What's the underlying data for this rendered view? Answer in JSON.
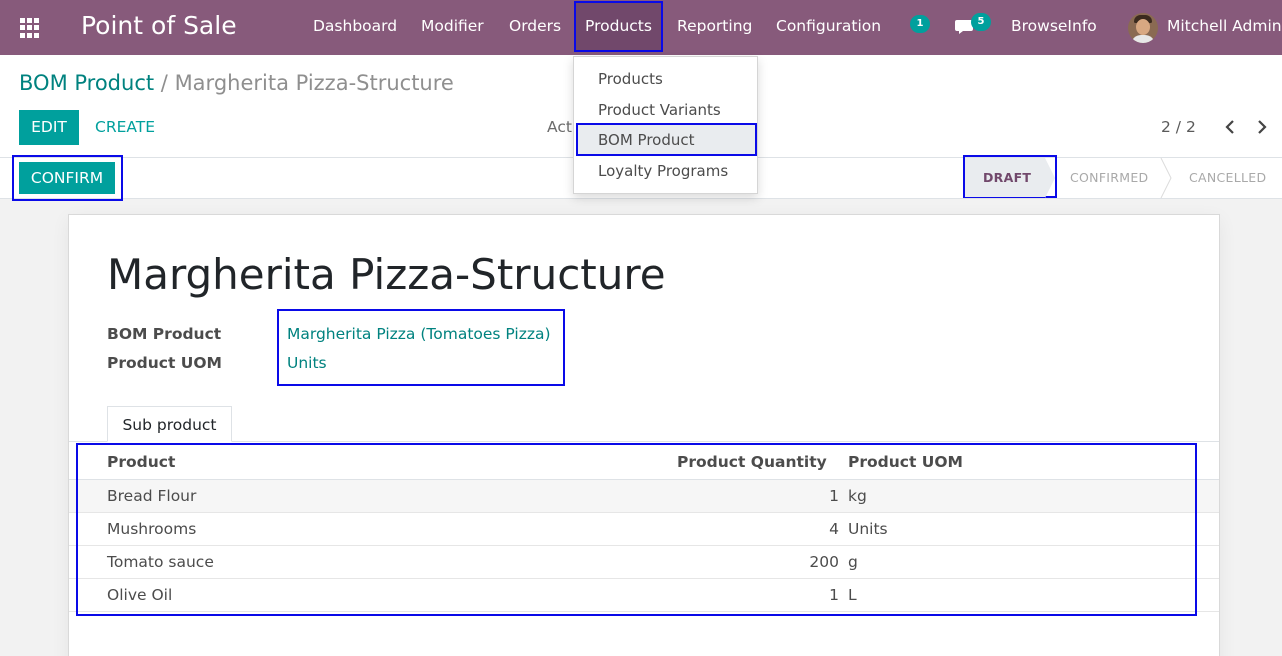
{
  "navbar": {
    "app_title": "Point of Sale",
    "menus": [
      "Dashboard",
      "Modifier",
      "Orders",
      "Products",
      "Reporting",
      "Configuration"
    ],
    "activity_badge": "1",
    "messages_badge": "5",
    "company": "BrowseInfo",
    "user": "Mitchell Admin"
  },
  "breadcrumb": {
    "parent": "BOM Product",
    "separator": "/",
    "current": "Margherita Pizza-Structure"
  },
  "buttons": {
    "edit": "EDIT",
    "create": "CREATE",
    "action": "Act",
    "confirm": "CONFIRM"
  },
  "pager": "2 / 2",
  "status_stages": [
    "DRAFT",
    "CONFIRMED",
    "CANCELLED"
  ],
  "dropdown": {
    "items": [
      "Products",
      "Product Variants",
      "BOM Product",
      "Loyalty Programs"
    ]
  },
  "form": {
    "title": "Margherita Pizza-Structure",
    "fields": [
      {
        "label": "BOM Product",
        "value": "Margherita Pizza (Tomatoes Pizza)"
      },
      {
        "label": "Product UOM",
        "value": "Units"
      }
    ],
    "tab": "Sub product",
    "table": {
      "headers": [
        "Product",
        "Product Quantity",
        "Product UOM"
      ],
      "rows": [
        {
          "product": "Bread Flour",
          "qty": "1",
          "uom": "kg"
        },
        {
          "product": "Mushrooms",
          "qty": "4",
          "uom": "Units"
        },
        {
          "product": "Tomato sauce",
          "qty": "200",
          "uom": "g"
        },
        {
          "product": "Olive Oil",
          "qty": "1",
          "uom": "L"
        }
      ]
    }
  },
  "colors": {
    "navbar": "#875a7b",
    "accent": "#00a09d",
    "link": "#00827f",
    "highlight_border": "#0a0ae8"
  }
}
